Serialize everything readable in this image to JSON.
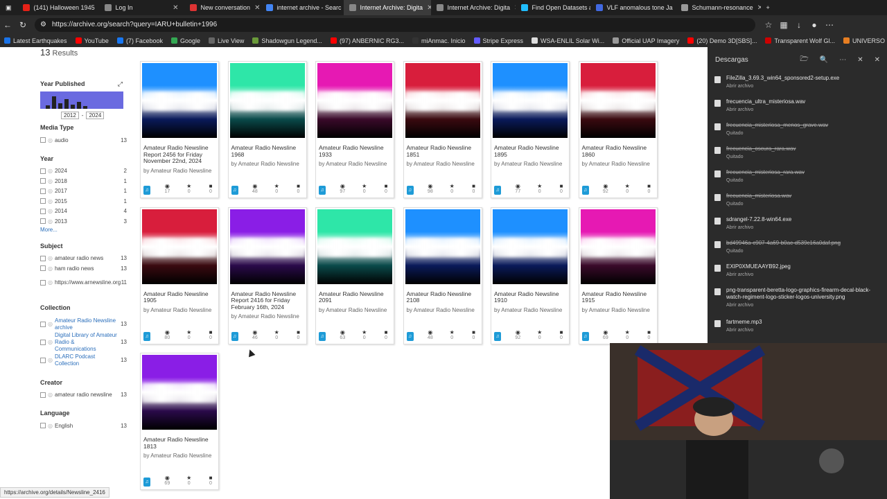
{
  "tabs": [
    {
      "label": "(141) Halloween 1945",
      "color": "#e62117"
    },
    {
      "label": "Log In",
      "color": "#888888"
    },
    {
      "label": "New conversation",
      "color": "#d33"
    },
    {
      "label": "internet archive - Searc",
      "color": "#4285f4"
    },
    {
      "label": "Internet Archive: Digita",
      "color": "#888888",
      "active": true
    },
    {
      "label": "Internet Archive: Digita",
      "color": "#888888"
    },
    {
      "label": "Find Open Datasets an",
      "color": "#20beff"
    },
    {
      "label": "VLF anomalous tone Ja",
      "color": "#4169e1"
    },
    {
      "label": "Schumann-resonance",
      "color": "#999999"
    }
  ],
  "url": "https://archive.org/search?query=IARU+bulletin+1996",
  "bookmarks": [
    {
      "label": "Latest Earthquakes",
      "color": "#1a73e8"
    },
    {
      "label": "YouTube",
      "color": "#ff0000"
    },
    {
      "label": "(7) Facebook",
      "color": "#1877f2"
    },
    {
      "label": "Google",
      "color": "#34a853"
    },
    {
      "label": "Live View",
      "color": "#666666"
    },
    {
      "label": "Shadowgun Legend...",
      "color": "#6a9a3a"
    },
    {
      "label": "(97) ANBERNIC RG3...",
      "color": "#ff0000"
    },
    {
      "label": "miAnmac. Inicio",
      "color": "#333333"
    },
    {
      "label": "Stripe Express",
      "color": "#635bff"
    },
    {
      "label": "WSA-ENLIL Solar Wi...",
      "color": "#dddddd"
    },
    {
      "label": "Official UAP Imagery",
      "color": "#999999"
    },
    {
      "label": "(20) Demo 3D[SBS]...",
      "color": "#ff0000"
    },
    {
      "label": "Transparent Wolf Gl...",
      "color": "#cc0000"
    },
    {
      "label": "UNIVERSO RETRO...",
      "color": "#e67e22"
    }
  ],
  "results": {
    "count": "13",
    "label": "Results"
  },
  "filters": {
    "year_published": {
      "title": "Year Published",
      "from": "2012",
      "to": "2024"
    },
    "media_type": {
      "title": "Media Type",
      "rows": [
        {
          "label": "audio",
          "count": "13"
        }
      ]
    },
    "year": {
      "title": "Year",
      "rows": [
        {
          "label": "2024",
          "count": "2"
        },
        {
          "label": "2018",
          "count": "1"
        },
        {
          "label": "2017",
          "count": "1"
        },
        {
          "label": "2015",
          "count": "1"
        },
        {
          "label": "2014",
          "count": "4"
        },
        {
          "label": "2013",
          "count": "3"
        }
      ],
      "more": "More..."
    },
    "subject": {
      "title": "Subject",
      "rows": [
        {
          "label": "amateur radio news",
          "count": "13"
        },
        {
          "label": "ham radio news",
          "count": "13"
        },
        {
          "label": "https://www.arnewsline.org",
          "count": "11"
        }
      ]
    },
    "collection": {
      "title": "Collection",
      "rows": [
        {
          "label": "Amateur Radio Newsline archive",
          "count": "13"
        },
        {
          "label": "Digital Library of Amateur Radio & Communications",
          "count": "13"
        },
        {
          "label": "DLARC Podcast Collection",
          "count": "13"
        }
      ]
    },
    "creator": {
      "title": "Creator",
      "rows": [
        {
          "label": "amateur radio newsline",
          "count": "13"
        }
      ]
    },
    "language": {
      "title": "Language",
      "rows": [
        {
          "label": "English",
          "count": "13"
        }
      ]
    }
  },
  "items": [
    {
      "title": "Amateur Radio Newsline Report 2456 for Friday November 22nd, 2024",
      "by": "by Amateur Radio Newsline",
      "views": "17",
      "favs": "0",
      "reviews": "0",
      "c1": "#1e90ff",
      "c2": "#0a1a5a"
    },
    {
      "title": "Amateur Radio Newsline 1968",
      "by": "by Amateur Radio Newsline",
      "views": "48",
      "favs": "0",
      "reviews": "0",
      "c1": "#2ee6a8",
      "c2": "#0a4a4a"
    },
    {
      "title": "Amateur Radio Newsline 1933",
      "by": "by Amateur Radio Newsline",
      "views": "97",
      "favs": "0",
      "reviews": "0",
      "c1": "#e619b3",
      "c2": "#3a0a2a"
    },
    {
      "title": "Amateur Radio Newsline 1851",
      "by": "by Amateur Radio Newsline",
      "views": "98",
      "favs": "0",
      "reviews": "0",
      "c1": "#d81e3c",
      "c2": "#3a0a10"
    },
    {
      "title": "Amateur Radio Newsline 1895",
      "by": "by Amateur Radio Newsline",
      "views": "77",
      "favs": "0",
      "reviews": "0",
      "c1": "#1e90ff",
      "c2": "#0a1a5a"
    },
    {
      "title": "Amateur Radio Newsline 1860",
      "by": "by Amateur Radio Newsline",
      "views": "92",
      "favs": "0",
      "reviews": "0",
      "c1": "#d81e3c",
      "c2": "#3a0a10"
    },
    {
      "title": "Amateur Radio Newsline 1905",
      "by": "by Amateur Radio Newsline",
      "views": "80",
      "favs": "0",
      "reviews": "0",
      "c1": "#d81e3c",
      "c2": "#3a0a10"
    },
    {
      "title": "Amateur Radio Newsline Report 2416 for Friday February 16th, 2024",
      "by": "by Amateur Radio Newsline",
      "views": "46",
      "favs": "0",
      "reviews": "0",
      "c1": "#8a1ee6",
      "c2": "#2a0a4a"
    },
    {
      "title": "Amateur Radio Newsline 2091",
      "by": "by Amateur Radio Newsline",
      "views": "63",
      "favs": "0",
      "reviews": "0",
      "c1": "#2ee6a8",
      "c2": "#0a4a4a"
    },
    {
      "title": "Amateur Radio Newsline 2108",
      "by": "by Amateur Radio Newsline",
      "views": "48",
      "favs": "0",
      "reviews": "0",
      "c1": "#1e90ff",
      "c2": "#0a1a5a"
    },
    {
      "title": "Amateur Radio Newsline 1910",
      "by": "by Amateur Radio Newsline",
      "views": "92",
      "favs": "0",
      "reviews": "0",
      "c1": "#1e90ff",
      "c2": "#0a1a5a"
    },
    {
      "title": "Amateur Radio Newsline 1915",
      "by": "by Amateur Radio Newsline",
      "views": "69",
      "favs": "0",
      "reviews": "0",
      "c1": "#e619b3",
      "c2": "#3a0a2a"
    },
    {
      "title": "Amateur Radio Newsline 1813",
      "by": "by Amateur Radio Newsline",
      "views": "69",
      "favs": "0",
      "reviews": "0",
      "c1": "#8a1ee6",
      "c2": "#2a0a4a"
    }
  ],
  "downloads": {
    "title": "Descargas",
    "entries": [
      {
        "name": "FileZilla_3.69.3_win64_sponsored2-setup.exe",
        "status": "Abrir archivo",
        "removed": false
      },
      {
        "name": "frecuencia_ultra_misteriosa.wav",
        "status": "Abrir archivo",
        "removed": false
      },
      {
        "name": "frecuencia_misteriosa_menos_grave.wav",
        "status": "Quitado",
        "removed": true
      },
      {
        "name": "frecuencia_oscura_rara.wav",
        "status": "Quitado",
        "removed": true
      },
      {
        "name": "frecuencia_misteriosa_rara.wav",
        "status": "Quitado",
        "removed": true
      },
      {
        "name": "frecuencia_misteriosa.wav",
        "status": "Quitado",
        "removed": true
      },
      {
        "name": "sdrangel-7.22.8-win64.exe",
        "status": "Abrir archivo",
        "removed": false
      },
      {
        "name": "bd49946a-c907-4a69-b0ac-d539c16a0daf.png",
        "status": "Quitado",
        "removed": true
      },
      {
        "name": "EXIP0XMUEAAYB92.jpeg",
        "status": "Abrir archivo",
        "removed": false
      },
      {
        "name": "png-transparent-beretta-logo-graphics-firearm-decal-black-watch-regiment-logo-sticker-logos-university.png",
        "status": "Abrir archivo",
        "removed": false
      },
      {
        "name": "fartmeme.mp3",
        "status": "Abrir archivo",
        "removed": false
      }
    ]
  },
  "status_url": "https://archive.org/details/Newsline_2416"
}
